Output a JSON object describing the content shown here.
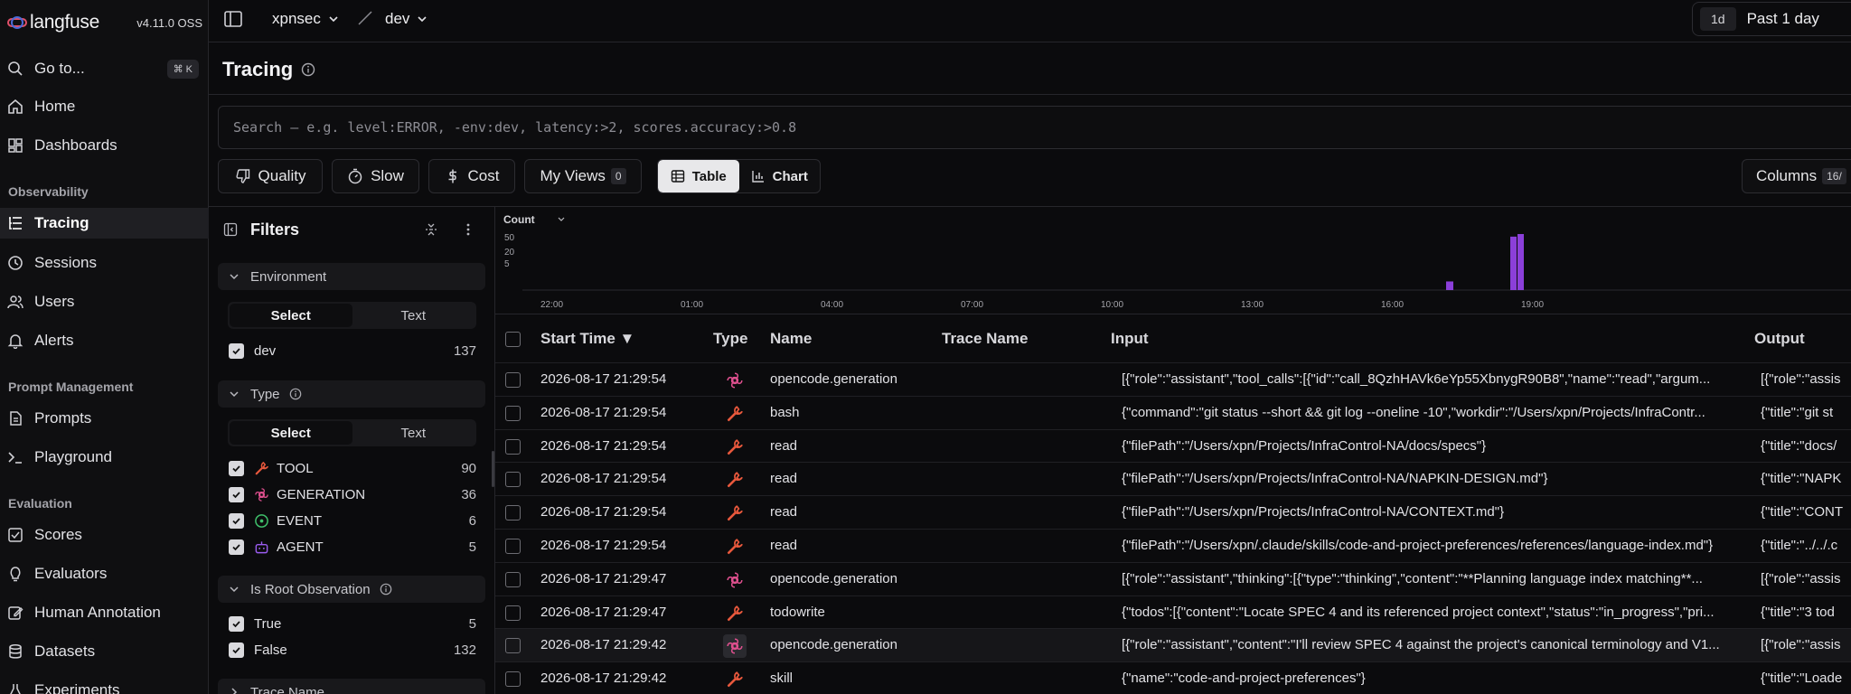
{
  "app": {
    "name": "langfuse",
    "version": "v4.11.0 OSS"
  },
  "sidebar": {
    "goto": {
      "label": "Go to...",
      "shortcut": "⌘ K"
    },
    "items": [
      {
        "label": "Home"
      },
      {
        "label": "Dashboards"
      }
    ],
    "sections": [
      {
        "title": "Observability",
        "items": [
          {
            "label": "Tracing",
            "active": true
          },
          {
            "label": "Sessions"
          },
          {
            "label": "Users"
          },
          {
            "label": "Alerts"
          }
        ]
      },
      {
        "title": "Prompt Management",
        "items": [
          {
            "label": "Prompts"
          },
          {
            "label": "Playground"
          }
        ]
      },
      {
        "title": "Evaluation",
        "items": [
          {
            "label": "Scores"
          },
          {
            "label": "Evaluators"
          },
          {
            "label": "Human Annotation"
          },
          {
            "label": "Datasets"
          },
          {
            "label": "Experiments"
          }
        ]
      }
    ]
  },
  "topbar": {
    "project": "xpnsec",
    "environment": "dev",
    "time_chip": "1d",
    "time_range": "Past 1 day"
  },
  "page": {
    "title": "Tracing"
  },
  "search": {
    "placeholder": "Search — e.g. level:ERROR, -env:dev, latency:>2, scores.accuracy:>0.8"
  },
  "toolbar": {
    "quality": "Quality",
    "slow": "Slow",
    "cost": "Cost",
    "my_views": "My Views",
    "my_views_count": "0",
    "table": "Table",
    "chart": "Chart",
    "columns": "Columns",
    "columns_count": "16/"
  },
  "filters": {
    "title": "Filters",
    "environment": {
      "title": "Environment",
      "tab_select": "Select",
      "tab_text": "Text",
      "options": [
        {
          "label": "dev",
          "count": "137"
        }
      ]
    },
    "type": {
      "title": "Type",
      "tab_select": "Select",
      "tab_text": "Text",
      "options": [
        {
          "label": "TOOL",
          "count": "90"
        },
        {
          "label": "GENERATION",
          "count": "36"
        },
        {
          "label": "EVENT",
          "count": "6"
        },
        {
          "label": "AGENT",
          "count": "5"
        }
      ]
    },
    "root": {
      "title": "Is Root Observation",
      "options": [
        {
          "label": "True",
          "count": "5"
        },
        {
          "label": "False",
          "count": "132"
        }
      ]
    },
    "trace_name": {
      "title": "Trace Name"
    }
  },
  "chart_data": {
    "type": "bar",
    "ylabel": "Count",
    "yticks": [
      "50",
      "20",
      "5"
    ],
    "x_ticks": [
      "22:00",
      "01:00",
      "04:00",
      "07:00",
      "10:00",
      "13:00",
      "16:00",
      "19:00"
    ],
    "bars": [
      {
        "x": 16.2,
        "value": 10
      },
      {
        "x": 17.6,
        "value": 62
      },
      {
        "x": 17.75,
        "value": 65
      }
    ],
    "ylim": [
      0,
      65
    ],
    "color": "#8b3fd9"
  },
  "table": {
    "headers": {
      "start_time": "Start Time ▼",
      "type": "Type",
      "name": "Name",
      "trace_name": "Trace Name",
      "input": "Input",
      "output": "Output"
    },
    "rows": [
      {
        "time": "2026-08-17 21:29:54",
        "type": "generation",
        "name": "opencode.generation",
        "input": "[{\"role\":\"assistant\",\"tool_calls\":[{\"id\":\"call_8QzhHAVk6eYp55XbnygR90B8\",\"name\":\"read\",\"argum...",
        "output": "[{\"role\":\"assis"
      },
      {
        "time": "2026-08-17 21:29:54",
        "type": "tool",
        "name": "bash",
        "input": "{\"command\":\"git status --short && git log --oneline -10\",\"workdir\":\"/Users/xpn/Projects/InfraContr...",
        "output": "{\"title\":\"git st"
      },
      {
        "time": "2026-08-17 21:29:54",
        "type": "tool",
        "name": "read",
        "input": "{\"filePath\":\"/Users/xpn/Projects/InfraControl-NA/docs/specs\"}",
        "output": "{\"title\":\"docs/"
      },
      {
        "time": "2026-08-17 21:29:54",
        "type": "tool",
        "name": "read",
        "input": "{\"filePath\":\"/Users/xpn/Projects/InfraControl-NA/NAPKIN-DESIGN.md\"}",
        "output": "{\"title\":\"NAPK"
      },
      {
        "time": "2026-08-17 21:29:54",
        "type": "tool",
        "name": "read",
        "input": "{\"filePath\":\"/Users/xpn/Projects/InfraControl-NA/CONTEXT.md\"}",
        "output": "{\"title\":\"CONT"
      },
      {
        "time": "2026-08-17 21:29:54",
        "type": "tool",
        "name": "read",
        "input": "{\"filePath\":\"/Users/xpn/.claude/skills/code-and-project-preferences/references/language-index.md\"}",
        "output": "{\"title\":\"../../.c"
      },
      {
        "time": "2026-08-17 21:29:47",
        "type": "generation",
        "name": "opencode.generation",
        "input": "[{\"role\":\"assistant\",\"thinking\":[{\"type\":\"thinking\",\"content\":\"**Planning language index matching**...",
        "output": "[{\"role\":\"assis"
      },
      {
        "time": "2026-08-17 21:29:47",
        "type": "tool",
        "name": "todowrite",
        "input": "{\"todos\":[{\"content\":\"Locate SPEC 4 and its referenced project context\",\"status\":\"in_progress\",\"pri...",
        "output": "{\"title\":\"3 tod"
      },
      {
        "time": "2026-08-17 21:29:42",
        "type": "generation",
        "name": "opencode.generation",
        "input": "[{\"role\":\"assistant\",\"content\":\"I'll review SPEC 4 against the project's canonical terminology and V1...",
        "output": "[{\"role\":\"assis",
        "selected": true
      },
      {
        "time": "2026-08-17 21:29:42",
        "type": "tool",
        "name": "skill",
        "input": "{\"name\":\"code-and-project-preferences\"}",
        "output": "{\"title\":\"Loade"
      }
    ]
  }
}
